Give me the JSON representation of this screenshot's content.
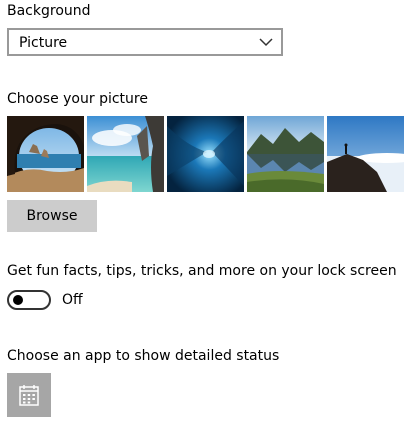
{
  "background": {
    "label": "Background",
    "dropdown_value": "Picture",
    "dropdown_icon": "chevron-down-icon"
  },
  "choose_picture": {
    "label": "Choose your picture",
    "thumbnails": [
      "sea-cave-beach-picture",
      "beach-lagoon-rock-arch-picture",
      "underwater-ice-tunnel-picture",
      "mountain-lake-reflection-picture",
      "hiker-on-rock-above-clouds-picture"
    ],
    "browse_label": "Browse"
  },
  "lock_screen_tips": {
    "label": "Get fun facts, tips, tricks, and more on your lock screen",
    "toggle_state": "Off"
  },
  "detailed_status": {
    "label": "Choose an app to show detailed status",
    "app_icon": "calendar-icon"
  },
  "colors": {
    "tile_background": "#a6a6a6",
    "button_background": "#cccccc"
  }
}
